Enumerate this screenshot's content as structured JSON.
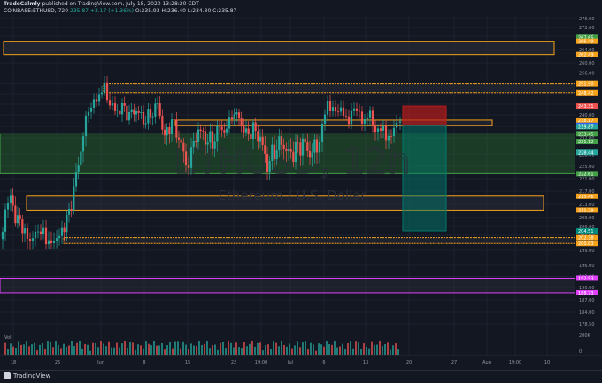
{
  "header": {
    "line1_author": "TradeCalmly",
    "line1_rest": " published on TradingView.com, July 18, 2020 13:28:20 CDT",
    "line2_symbol": "COINBASE:ETHUSD, 720",
    "line2_last": "235.87",
    "line2_change": "+3.17 (+1.36%)",
    "line2_ohlc": "O:235.93  H:236.40  L:234.30  C:235.87"
  },
  "watermark": {
    "symbol": "ETHUSD, 12h",
    "name": "Ethereum / U.S. Dollar"
  },
  "volume_label": "Vol",
  "footer_logo": "TradingView",
  "colors": {
    "background": "#131722",
    "up": "#26a69a",
    "down": "#ef5350",
    "zone_orange": "#f7a21b",
    "green_zone": "#2e7d32",
    "red_box": "#b71c1c",
    "teal_box": "#00796b",
    "magenta": "#e040fb",
    "axis_text": "#9598a1"
  },
  "chart_data": {
    "type": "candlestick",
    "symbol": "COINBASE:ETHUSD",
    "interval": "720",
    "y_axis_ticks": [
      "276.00",
      "272.00",
      "268.00",
      "264.00",
      "260.00",
      "256.00",
      "252.00",
      "248.00",
      "244.00",
      "240.00",
      "236.00",
      "232.00",
      "228.00",
      "225.00",
      "221.00",
      "217.00",
      "213.00",
      "209.00",
      "206.00",
      "203.00",
      "199.00",
      "196.00",
      "193.00",
      "190.00",
      "187.00",
      "184.00",
      "178.50",
      "200K",
      "0"
    ],
    "x_axis_ticks": [
      "18",
      "25",
      "Jun",
      "8",
      "15",
      "22",
      "19:00",
      "Jul",
      "6",
      "13",
      "20",
      "27",
      "Aug",
      "19:00",
      "10"
    ],
    "price_tags": [
      {
        "value": "267.65",
        "color": "#43a047"
      },
      {
        "value": "266.49",
        "color": "#f7a21b"
      },
      {
        "value": "262.49",
        "color": "#f7a21b"
      },
      {
        "value": "251.90",
        "color": "#f7a21b"
      },
      {
        "value": "248.42",
        "color": "#f7a21b"
      },
      {
        "value": "243.31",
        "color": "#ef5350"
      },
      {
        "value": "238.17",
        "color": "#f7a21b"
      },
      {
        "value": "236.37",
        "color": "#2962ff"
      },
      {
        "value": "235.87",
        "color": "#26a69a"
      },
      {
        "value": "233.45",
        "color": "#43a047"
      },
      {
        "value": "231.12",
        "color": "#43a047"
      },
      {
        "value": "228.44",
        "color": "#26a69a"
      },
      {
        "value": "222.61",
        "color": "#43a047"
      },
      {
        "value": "215.46",
        "color": "#f7a21b"
      },
      {
        "value": "211.29",
        "color": "#f7a21b"
      },
      {
        "value": "204.51",
        "color": "#00897b"
      },
      {
        "value": "202.38",
        "color": "#f7a21b"
      },
      {
        "value": "200.83",
        "color": "#f7a21b"
      },
      {
        "value": "192.53",
        "color": "#e040fb"
      },
      {
        "value": "188.73",
        "color": "#e040fb"
      }
    ]
  }
}
